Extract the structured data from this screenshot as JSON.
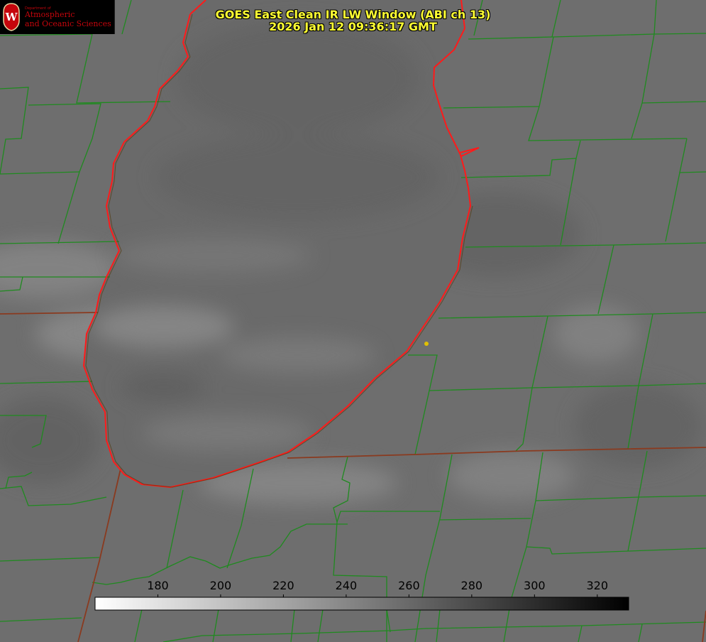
{
  "header": {
    "title_line1": "GOES East Clean IR LW Window (ABI ch 13)",
    "title_line2": "2026 Jan 12 09:36:17 GMT"
  },
  "logo": {
    "dept": "Department of",
    "line1": "Atmospheric",
    "line2": "and Oceanic Sciences",
    "crest_letter": "W"
  },
  "colors": {
    "county_lines": "#1f8a1f",
    "shoreline": "#ff1a1a",
    "state_line": "#8a3a1f",
    "title_text": "#ffff33",
    "marker": "#e0c000"
  },
  "colorbar": {
    "min": 160,
    "max": 330,
    "ticks": [
      "180",
      "200",
      "220",
      "240",
      "260",
      "280",
      "300",
      "320"
    ],
    "from_color": "#ffffff",
    "to_color": "#000000"
  }
}
